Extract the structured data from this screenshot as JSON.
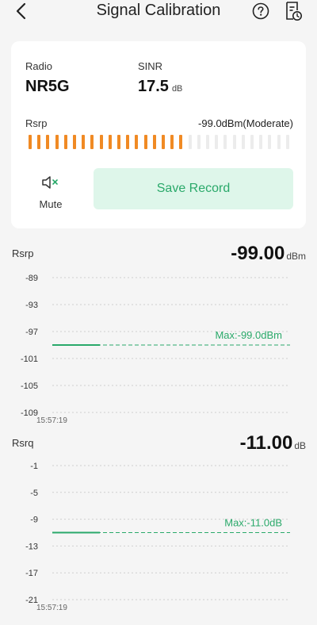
{
  "header": {
    "title": "Signal Calibration",
    "back_icon": "back-chevron-icon",
    "help_icon": "help-circle-icon",
    "history_icon": "record-history-icon"
  },
  "card": {
    "radio_label": "Radio",
    "radio_value": "NR5G",
    "sinr_label": "SINR",
    "sinr_value": "17.5",
    "sinr_unit": "dB",
    "rsrp_label": "Rsrp",
    "rsrp_value": "-99.0dBm(Moderate)",
    "signal_bar": {
      "total_segments": 30,
      "active_segments": 18,
      "active_color": "#f08a24",
      "inactive_color": "#ececec"
    },
    "mute_label": "Mute",
    "save_label": "Save Record"
  },
  "charts": [
    {
      "title": "Rsrp",
      "value": "-99.00",
      "unit": "dBm",
      "ylabels": [
        "-89",
        "-93",
        "-97",
        "-101",
        "-105",
        "-109"
      ],
      "yticks": [
        -89,
        -93,
        -97,
        -101,
        -105,
        -109
      ],
      "time_label": "15:57:19",
      "max_label": "Max:-99.0dBm",
      "series_value": -99.0,
      "max_value": -99.0
    },
    {
      "title": "Rsrq",
      "value": "-11.00",
      "unit": "dB",
      "ylabels": [
        "-1",
        "-5",
        "-9",
        "-13",
        "-17",
        "-21"
      ],
      "yticks": [
        -1,
        -5,
        -9,
        -13,
        -17,
        -21
      ],
      "time_label": "15:57:19",
      "max_label": "Max:-11.0dB",
      "series_value": -11.0,
      "max_value": -11.0
    }
  ],
  "colors": {
    "accent_green": "#2aa96a",
    "orange": "#f08a24"
  }
}
